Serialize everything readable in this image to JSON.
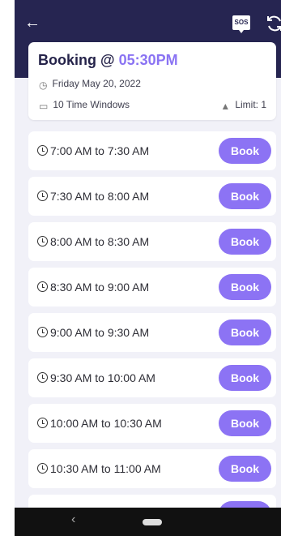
{
  "header": {
    "back_icon": "arrow-left",
    "sos_label": "SOS",
    "refresh_icon": "refresh"
  },
  "booking": {
    "title_prefix": "Booking @",
    "time": "05:30PM",
    "date": "Friday May 20, 2022",
    "windows": "10 Time Windows",
    "limit": "Limit: 1"
  },
  "slots": [
    {
      "label": "7:00 AM to 7:30 AM",
      "button": "Book"
    },
    {
      "label": "7:30 AM to 8:00 AM",
      "button": "Book"
    },
    {
      "label": "8:00 AM to 8:30 AM",
      "button": "Book"
    },
    {
      "label": "8:30 AM to 9:00 AM",
      "button": "Book"
    },
    {
      "label": "9:00 AM to 9:30 AM",
      "button": "Book"
    },
    {
      "label": "9:30 AM to 10:00 AM",
      "button": "Book"
    },
    {
      "label": "10:00 AM to 10:30 AM",
      "button": "Book"
    },
    {
      "label": "10:30 AM to 11:00 AM",
      "button": "Book"
    },
    {
      "label": "",
      "button": ""
    }
  ],
  "colors": {
    "header": "#262551",
    "accent": "#8c73f4"
  }
}
